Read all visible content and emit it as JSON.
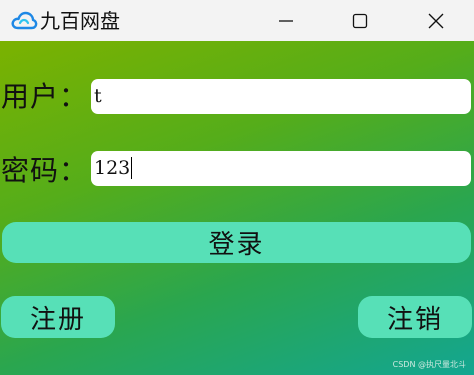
{
  "window": {
    "title": "九百网盘",
    "controls": {
      "minimize_icon": "minimize-icon",
      "maximize_icon": "maximize-icon",
      "close_icon": "close-icon"
    }
  },
  "form": {
    "user_label": "用户：",
    "user_value": "t",
    "password_label": "密码：",
    "password_value": "123"
  },
  "buttons": {
    "login": "登录",
    "register": "注册",
    "logout": "注销"
  },
  "watermark": "CSDN @执尺量北斗",
  "colors": {
    "button": "#57e0b7",
    "gradient_start": "#7bb200",
    "gradient_end": "#13a691",
    "titlebar": "#f3f3f3"
  }
}
